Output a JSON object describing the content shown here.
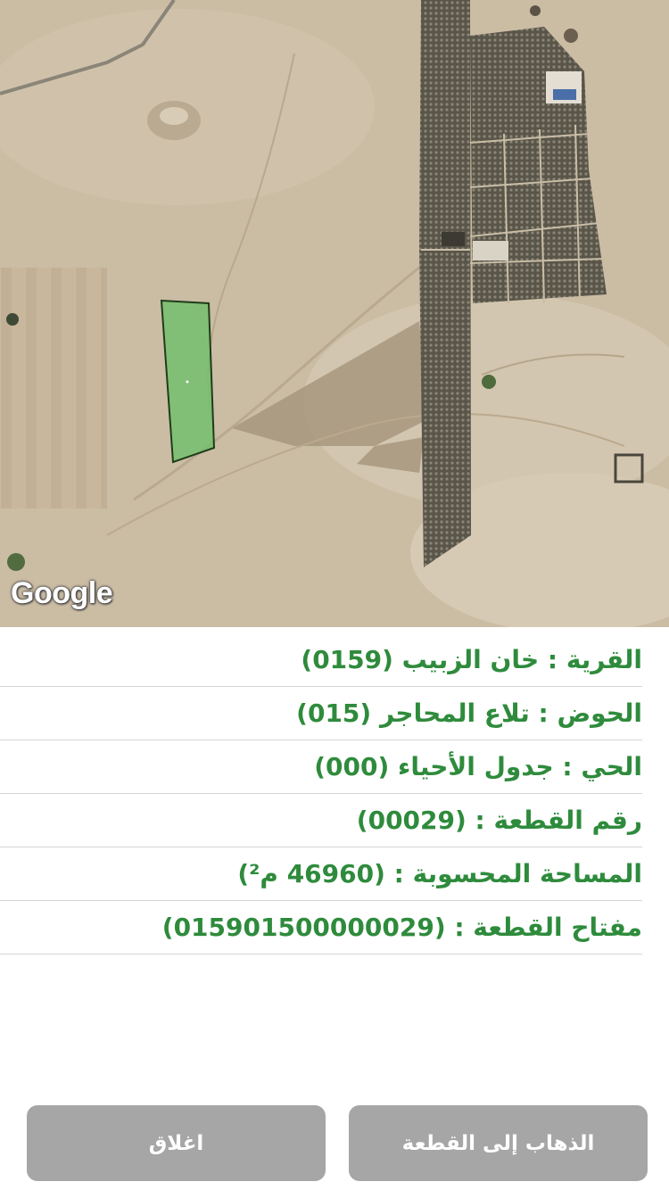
{
  "map": {
    "attribution": "Google",
    "parcel_color": "#6fbf6a"
  },
  "info": {
    "village": "القرية : خان الزبيب (0159)",
    "basin": "الحوض : تلاع المحاجر (015)",
    "district": "الحي : جدول الأحياء (000)",
    "parcel_number": "رقم القطعة : (00029)",
    "area": "المساحة المحسوبة : (46960 م²)",
    "parcel_key": "مفتاح القطعة : (015901500000029)"
  },
  "buttons": {
    "go_to_parcel": "الذهاب إلى القطعة",
    "close": "اغلاق"
  },
  "colors": {
    "text_green": "#2e8b3c",
    "button_gray": "#a6a6a6"
  }
}
